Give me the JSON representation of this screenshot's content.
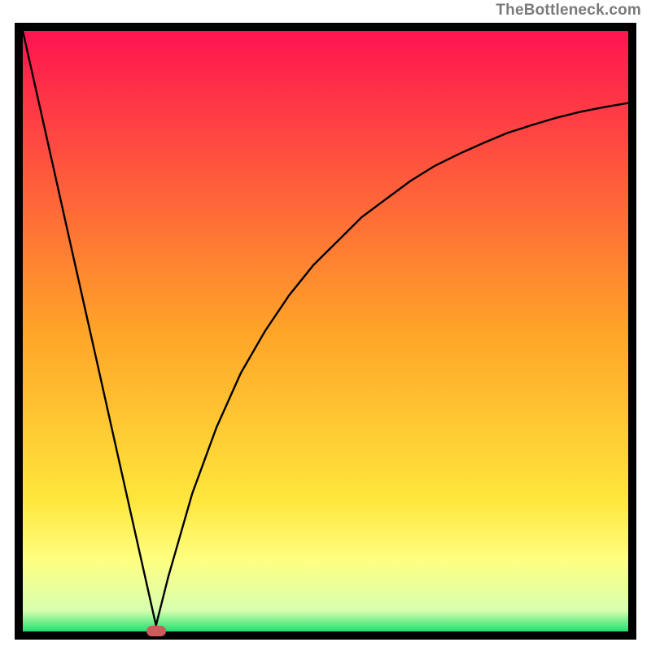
{
  "attribution": "TheBottleneck.com",
  "colors": {
    "frame": "#000000",
    "curve": "#000000",
    "marker": "#cc5b5b",
    "attribution_text": "#7a7a7a",
    "gradient_stops": [
      {
        "offset": 0.0,
        "color": "#ff1450"
      },
      {
        "offset": 0.5,
        "color": "#ffa428"
      },
      {
        "offset": 0.78,
        "color": "#ffe63c"
      },
      {
        "offset": 0.88,
        "color": "#ffff80"
      },
      {
        "offset": 0.965,
        "color": "#d8ffb0"
      },
      {
        "offset": 1.0,
        "color": "#20e070"
      }
    ]
  },
  "chart_data": {
    "type": "line",
    "title": "",
    "xlabel": "",
    "ylabel": "",
    "xlim": [
      0,
      100
    ],
    "ylim": [
      0,
      100
    ],
    "grid": false,
    "legend": false,
    "notes": "Bottleneck-style curve. Minimum (marker) near x≈22. Left branch nearly linear from top-left corner to the minimum; right branch rises with decreasing slope, ending near y≈88 at x=100. Values estimated from pixels; no axis ticks shown.",
    "marker_x": 22,
    "series": [
      {
        "name": "curve",
        "x": [
          0,
          4,
          8,
          12,
          16,
          20,
          22,
          24,
          28,
          32,
          36,
          40,
          44,
          48,
          52,
          56,
          60,
          64,
          68,
          72,
          76,
          80,
          84,
          88,
          92,
          96,
          100
        ],
        "values": [
          100,
          82,
          64,
          46,
          28,
          10,
          1,
          9,
          23,
          34,
          43,
          50,
          56,
          61,
          65,
          69,
          72,
          75,
          77.5,
          79.5,
          81.3,
          83,
          84.3,
          85.5,
          86.5,
          87.3,
          88
        ]
      }
    ]
  }
}
